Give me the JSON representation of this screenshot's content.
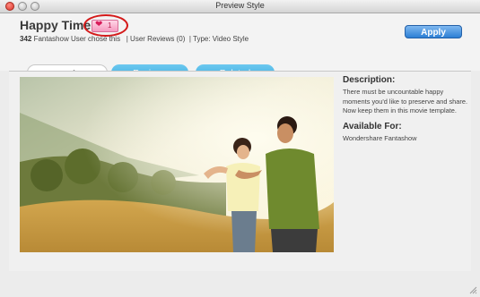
{
  "window": {
    "title": "Preview Style"
  },
  "style": {
    "name": "Happy Time",
    "likes": "1",
    "users_count": "342",
    "users_text": " Fantashow User chose this",
    "reviews": "| User Reviews (0)",
    "type": "| Type: Video Style"
  },
  "actions": {
    "apply_label": "Apply"
  },
  "tabs": [
    {
      "label": "Overview",
      "active": true
    },
    {
      "label": "Reviews",
      "active": false
    },
    {
      "label": "Related",
      "active": false
    }
  ],
  "details": {
    "description_heading": "Description:",
    "description_text": "There must be uncountable happy moments you'd like to preserve and share. Now keep them in this movie template.",
    "available_heading": "Available For:",
    "available_text": "Wondershare Fantashow"
  },
  "colors": {
    "tab_blue": "#3bb0e3",
    "apply_blue": "#2c7fd4",
    "highlight_red": "#d41a1a"
  }
}
